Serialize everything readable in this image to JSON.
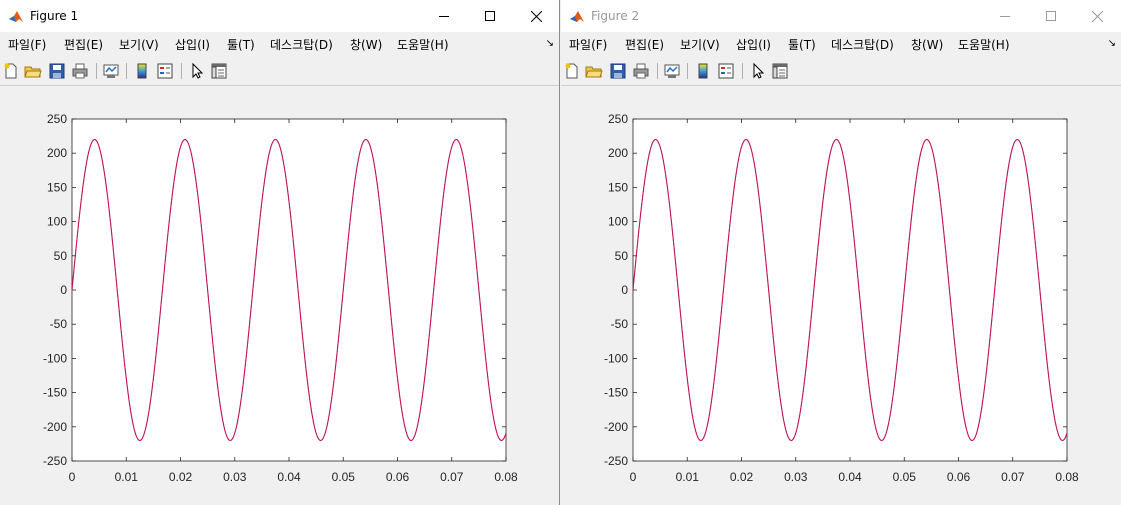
{
  "windows": [
    {
      "title": "Figure 1",
      "active": true,
      "menu": [
        "파일(F)",
        "편집(E)",
        "보기(V)",
        "삽입(I)",
        "툴(T)",
        "데스크탑(D)",
        "창(W)",
        "도움말(H)"
      ],
      "menu_more": "↘"
    },
    {
      "title": "Figure 2",
      "active": false,
      "menu": [
        "파일(F)",
        "편집(E)",
        "보기(V)",
        "삽입(I)",
        "툴(T)",
        "데스크탑(D)",
        "창(W)",
        "도움말(H)"
      ],
      "menu_more": "↘"
    }
  ],
  "toolbar_icons": [
    "new-figure-icon",
    "open-file-icon",
    "save-icon",
    "print-icon",
    "link-plot-icon",
    "insert-colorbar-icon",
    "insert-legend-icon",
    "edit-plot-pointer-icon",
    "property-inspector-icon"
  ],
  "colors": {
    "line": "#cc1050",
    "line_secondary": "#4a2aa0",
    "axes_bg": "#ffffff",
    "figure_bg": "#f0f0f0",
    "matlab_logo": "#e05a1a"
  },
  "chart_data": [
    {
      "type": "line",
      "title": "",
      "xlabel": "",
      "ylabel": "",
      "xlim": [
        0,
        0.08
      ],
      "ylim": [
        -250,
        250
      ],
      "xticks": [
        "0",
        "0.01",
        "0.02",
        "0.03",
        "0.04",
        "0.05",
        "0.06",
        "0.07",
        "0.08"
      ],
      "yticks": [
        "250",
        "200",
        "150",
        "100",
        "50",
        "0",
        "-50",
        "-100",
        "-150",
        "-200",
        "-250"
      ],
      "grid": false,
      "series": [
        {
          "function": "220*sin(2*pi*60*t)",
          "amplitude": 220,
          "frequency_hz": 60,
          "t_start": 0,
          "t_end": 0.08
        }
      ]
    },
    {
      "type": "line",
      "title": "",
      "xlabel": "",
      "ylabel": "",
      "xlim": [
        0,
        0.08
      ],
      "ylim": [
        -250,
        250
      ],
      "xticks": [
        "0",
        "0.01",
        "0.02",
        "0.03",
        "0.04",
        "0.05",
        "0.06",
        "0.07",
        "0.08"
      ],
      "yticks": [
        "250",
        "200",
        "150",
        "100",
        "50",
        "0",
        "-50",
        "-100",
        "-150",
        "-200",
        "-250"
      ],
      "grid": false,
      "series": [
        {
          "function": "220*sin(2*pi*60*t)",
          "amplitude": 220,
          "frequency_hz": 60,
          "t_start": 0,
          "t_end": 0.08
        }
      ]
    }
  ]
}
